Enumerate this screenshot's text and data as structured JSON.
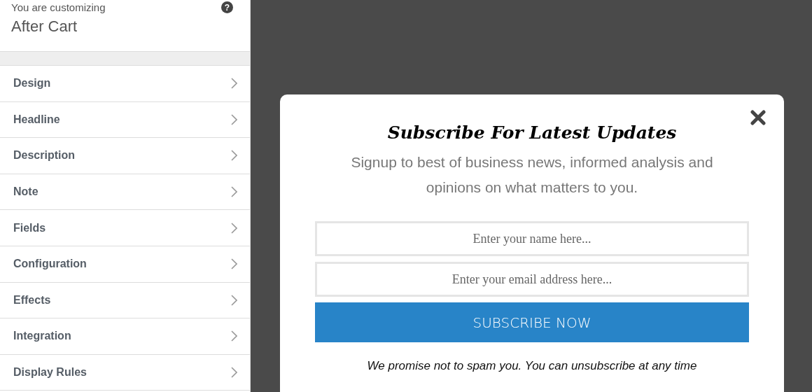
{
  "sidebar": {
    "caption": "You are customizing",
    "title": "After Cart",
    "help": "?",
    "items": [
      {
        "label": "Design"
      },
      {
        "label": "Headline"
      },
      {
        "label": "Description"
      },
      {
        "label": "Note"
      },
      {
        "label": "Fields"
      },
      {
        "label": "Configuration"
      },
      {
        "label": "Effects"
      },
      {
        "label": "Integration"
      },
      {
        "label": "Display Rules"
      }
    ]
  },
  "popup": {
    "headline": "Subscribe For Latest Updates",
    "description": "Signup to best of business news, informed analysis and opinions on what matters to you.",
    "fields": [
      {
        "placeholder": "Enter your name here..."
      },
      {
        "placeholder": "Enter your email address here..."
      }
    ],
    "button": "SUBSCRIBE NOW",
    "note": "We promise not to spam you. You can unsubscribe at any time"
  }
}
